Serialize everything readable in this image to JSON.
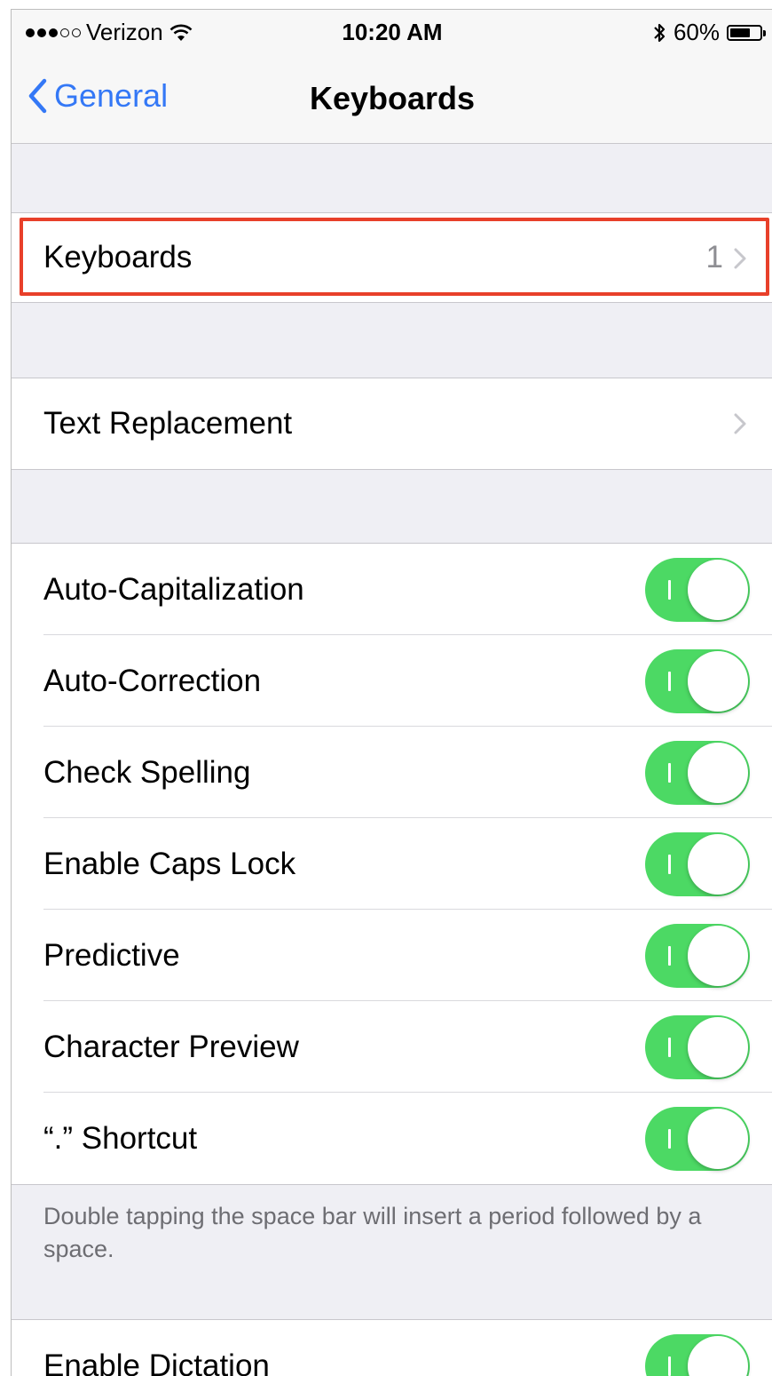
{
  "status_bar": {
    "carrier": "Verizon",
    "time": "10:20 AM",
    "battery": "60%",
    "signal_bars_filled": 3,
    "signal_bars_total": 5
  },
  "nav": {
    "back_label": "General",
    "title": "Keyboards"
  },
  "keyboards_row": {
    "label": "Keyboards",
    "count": "1"
  },
  "text_replacement_row": {
    "label": "Text Replacement"
  },
  "toggles": [
    {
      "label": "Auto-Capitalization",
      "on": true
    },
    {
      "label": "Auto-Correction",
      "on": true
    },
    {
      "label": "Check Spelling",
      "on": true
    },
    {
      "label": "Enable Caps Lock",
      "on": true
    },
    {
      "label": "Predictive",
      "on": true
    },
    {
      "label": "Character Preview",
      "on": true
    },
    {
      "label": "“.” Shortcut",
      "on": true
    }
  ],
  "footnote": "Double tapping the space bar will insert a period followed by a space.",
  "dictation_row": {
    "label": "Enable Dictation",
    "on": true
  },
  "colors": {
    "accent": "#3478f6",
    "toggle_on": "#4cd964",
    "highlight": "#e8402a",
    "background": "#efeff4"
  }
}
